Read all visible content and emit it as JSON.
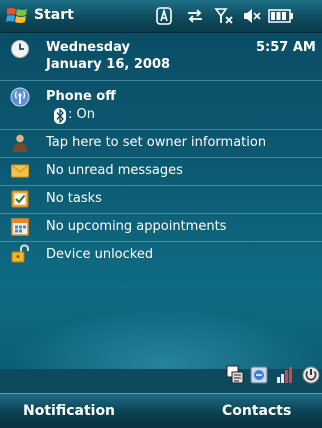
{
  "title_bar": {
    "title": "Start",
    "icons": [
      "windows-start-logo-icon",
      "input-method-icon",
      "sync-arrows-icon",
      "no-signal-icon",
      "speaker-mute-icon",
      "battery-icon"
    ]
  },
  "today": {
    "datetime": {
      "day": "Wednesday",
      "date": "January 16, 2008",
      "time": "5:57 AM",
      "icon": "clock-icon"
    },
    "phone": {
      "status": "Phone off",
      "bluetooth_label": ": On",
      "icon": "antenna-icon"
    },
    "items": [
      {
        "label": "Tap here to set owner information",
        "icon": "person-icon"
      },
      {
        "label": "No unread messages",
        "icon": "envelope-icon"
      },
      {
        "label": "No tasks",
        "icon": "tasks-checkbox-icon"
      },
      {
        "label": "No upcoming appointments",
        "icon": "calendar-icon"
      },
      {
        "label": "Device unlocked",
        "icon": "padlock-open-icon"
      }
    ]
  },
  "tray": {
    "icons": [
      "keyboard-icon",
      "connection-icon",
      "signal-off-icon",
      "power-icon"
    ]
  },
  "softkeys": {
    "left": "Notification",
    "right": "Contacts"
  },
  "colors": {
    "background": "#0d4a5e",
    "divider": "#78c8dc",
    "text": "#ffffff"
  }
}
